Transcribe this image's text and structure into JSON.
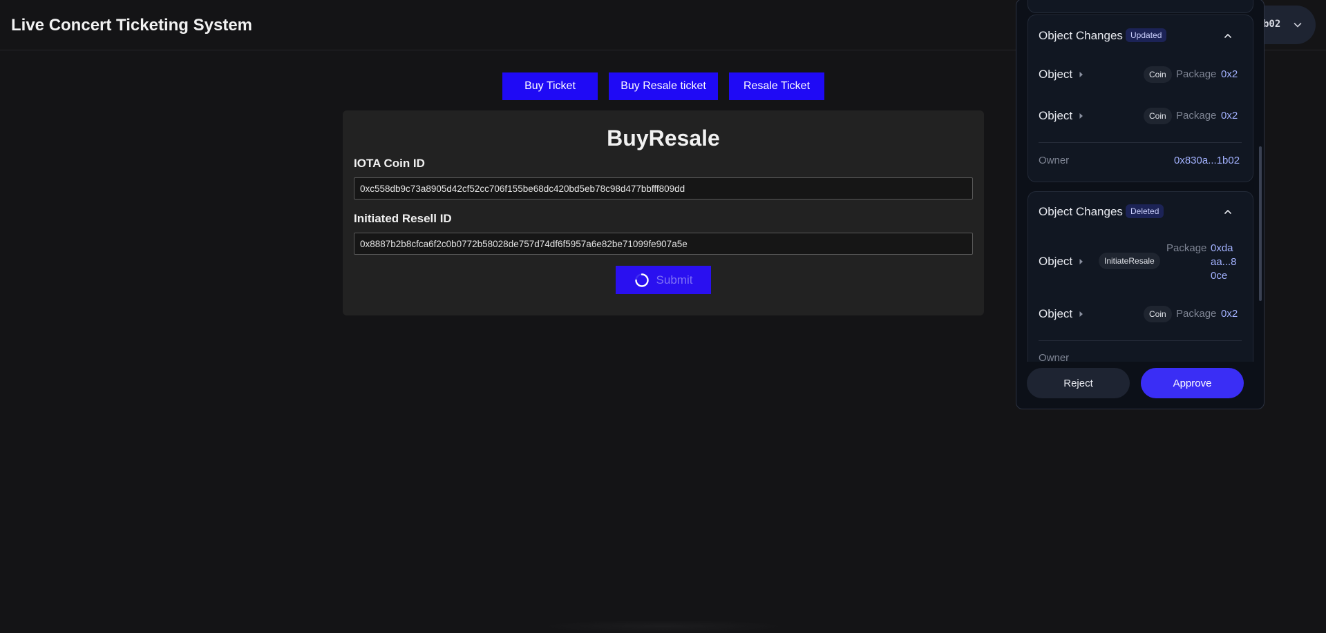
{
  "header": {
    "title": "Live Concert Ticketing System",
    "wallet_label": "b02"
  },
  "tabs": [
    {
      "label": "Buy Ticket"
    },
    {
      "label": "Buy Resale ticket"
    },
    {
      "label": "Resale Ticket"
    }
  ],
  "form": {
    "title": "BuyResale",
    "coin_label": "IOTA Coin ID",
    "coin_value": "0xc558db9c73a8905d42cf52cc706f155be68dc420bd5eb78c98d477bbfff809dd",
    "resell_label": "Initiated Resell ID",
    "resell_value": "0x8887b2b8cfca6f2c0b0772b58028de757d74df6f5957a6e82be71099fe907a5e",
    "submit_label": "Submit"
  },
  "popup": {
    "updated": {
      "title": "Object Changes",
      "badge": "Updated",
      "rows": [
        {
          "label": "Object",
          "chip": "Coin",
          "pkg_label": "Package",
          "pkg_value": "0x2"
        },
        {
          "label": "Object",
          "chip": "Coin",
          "pkg_label": "Package",
          "pkg_value": "0x2"
        }
      ],
      "owner_label": "Owner",
      "owner_value": "0x830a...1b02"
    },
    "deleted": {
      "title": "Object Changes",
      "badge": "Deleted",
      "rows": [
        {
          "label": "Object",
          "chip": "InitiateResale",
          "pkg_label": "Package",
          "pkg_value_lines": [
            "0xda",
            "aa...8",
            "0ce"
          ]
        },
        {
          "label": "Object",
          "chip": "Coin",
          "pkg_label": "Package",
          "pkg_value": "0x2"
        }
      ],
      "owner_label": "Owner"
    },
    "reject_label": "Reject",
    "approve_label": "Approve"
  },
  "colors": {
    "background": "#141416",
    "tab_button": "#1f0af5",
    "approve": "#3a2ef5",
    "link": "#a3b2ff"
  }
}
